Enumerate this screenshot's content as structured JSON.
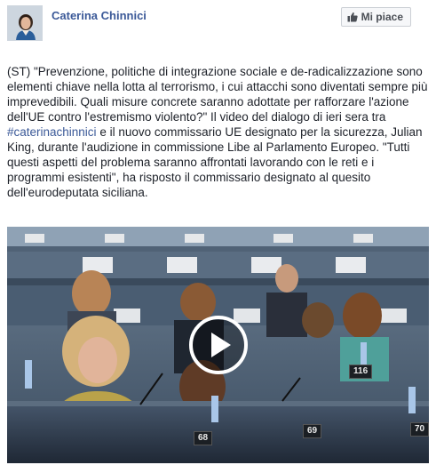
{
  "post": {
    "author_name": "Caterina Chinnici",
    "like_button_label": "Mi piace",
    "text_part1": "(ST) \"Prevenzione, politiche di integrazione sociale e de-radicalizzazione sono elementi chiave nella lotta al terrorismo, i cui attacchi sono diventati sempre più imprevedibili. Quali misure concrete saranno adottate per rafforzare l'azione dell'UE contro l'estremismo violento?\" Il video del dialogo di ieri sera tra ",
    "hashtag": "#caterinachinnici",
    "text_part2": " e il nuovo commissario UE designato per la sicurezza, Julian King, durante l'audizione in commissione Libe al Parlamento Europeo. \"Tutti questi aspetti del problema saranno affrontati lavorando con le reti e i programmi esistenti\", ha risposto il commissario designato al quesito dell'eurodeputata siciliana.",
    "colors": {
      "author": "#3b5998",
      "hashtag": "#3b5998",
      "like_border": "#ccd0d5"
    }
  },
  "video": {
    "seat_plates": [
      "68",
      "69",
      "70",
      "116"
    ],
    "icons": {
      "play": "play-icon",
      "like": "thumbs-up-icon"
    }
  }
}
